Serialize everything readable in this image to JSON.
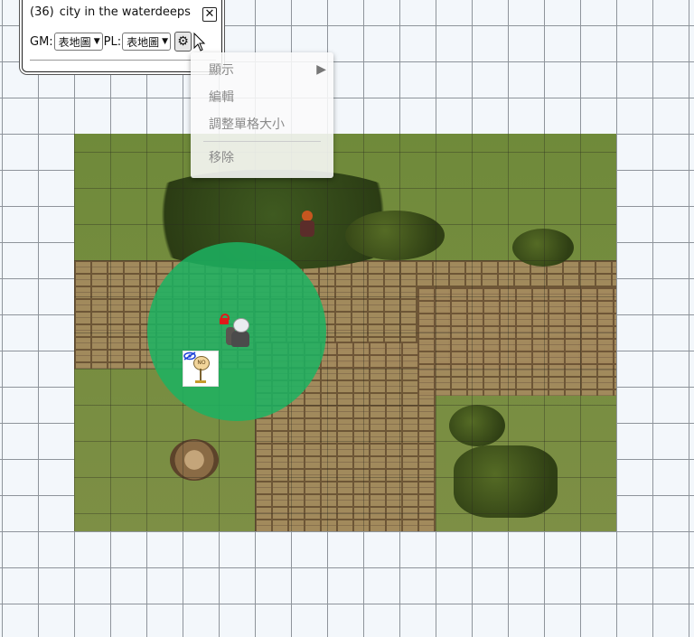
{
  "panel": {
    "number": "(36)",
    "title": "city in the waterdeeps",
    "close_label": "✕",
    "gm_label": "GM:",
    "gm_value": "表地圖",
    "pl_label": "PL:",
    "pl_value": "表地圖",
    "gear_glyph": "⚙"
  },
  "context_menu": {
    "items": [
      {
        "label": "顯示",
        "has_submenu": true
      },
      {
        "label": "編輯",
        "has_submenu": false
      },
      {
        "label": "調整單格大小",
        "has_submenu": false
      },
      {
        "label": "移除",
        "has_submenu": false
      }
    ],
    "submenu_arrow": "▶"
  },
  "map": {
    "sign_text": "NO"
  },
  "colors": {
    "aura": "#1bb362",
    "lock": "#e01a1a",
    "grid_line": "#8e949b",
    "background": "#f3f7fb"
  }
}
